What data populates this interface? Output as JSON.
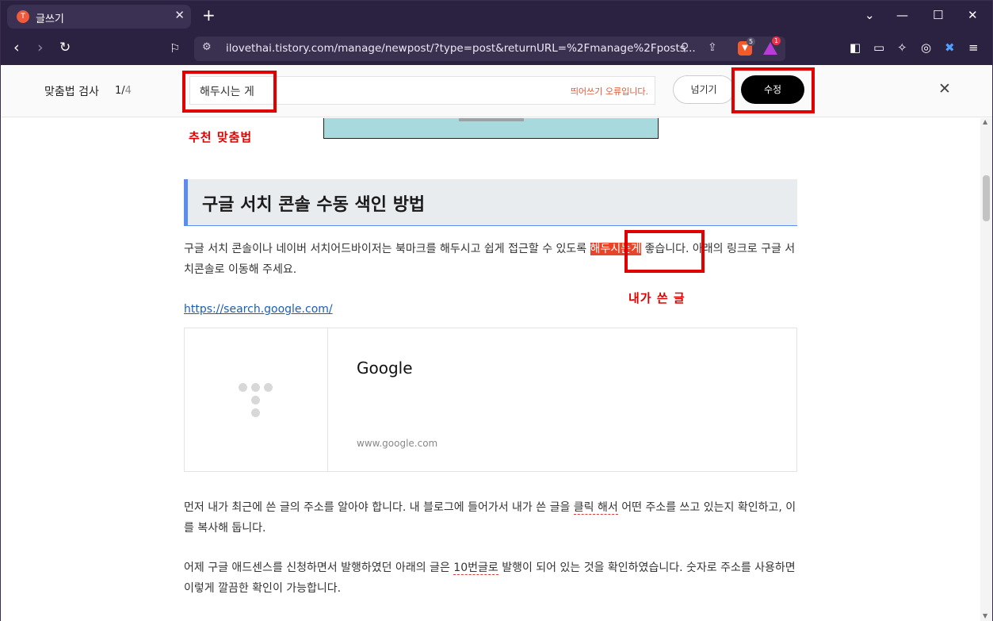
{
  "browser": {
    "tab_title": "글쓰기",
    "tab_favicon": "tistory-icon",
    "url_text": "ilovethai.tistory.com/manage/newpost/?type=post&returnURL=%2Fmanage%2Fposts...",
    "shield_count": "5",
    "rewards_count": "1"
  },
  "spellcheck": {
    "label": "맞춤법 검사",
    "current": "1/",
    "total": "4",
    "word": "해두시는 게",
    "error_text": "띄어쓰기 오류입니다.",
    "skip_label": "넘기기",
    "fix_label": "수정"
  },
  "annotations": {
    "suggestion_label": "추천 맞춤법",
    "mine_label": "내가 쓴 글"
  },
  "article": {
    "heading": "구글 서치 콘솔 수동 색인 방법",
    "p1_a": " 구글 서치 콘솔이나 네이버 서치어드바이저는 북마크를 해두시고 쉽게 접근할 수 있도록 ",
    "p1_hl": "해두시는게",
    "p1_b": " 좋습니다. 아래의 링크로 구글 서치콘솔로 이동해 주세요.",
    "link": "https://search.google.com/",
    "card_title": "Google",
    "card_url": "www.google.com",
    "p2_a": "먼저 내가 최근에 쓴 글의 주소를 알아야 합니다. 내 블로그에 들어가서 내가 쓴 글을 ",
    "p2_ul": "클릭 해서",
    "p2_b": " 어떤 주소를 쓰고 있는지 확인하고, 이를 복사해 둡니다.",
    "p3_a": "어제 구글 애드센스를 신청하면서 발행하였던 아래의 글은 ",
    "p3_ul": "10번글로",
    "p3_b": " 발행이 되어 있는 것을 확인하였습니다. 숫자로 주소를 사용하면 이렇게 깔끔한 확인이 가능합니다."
  }
}
